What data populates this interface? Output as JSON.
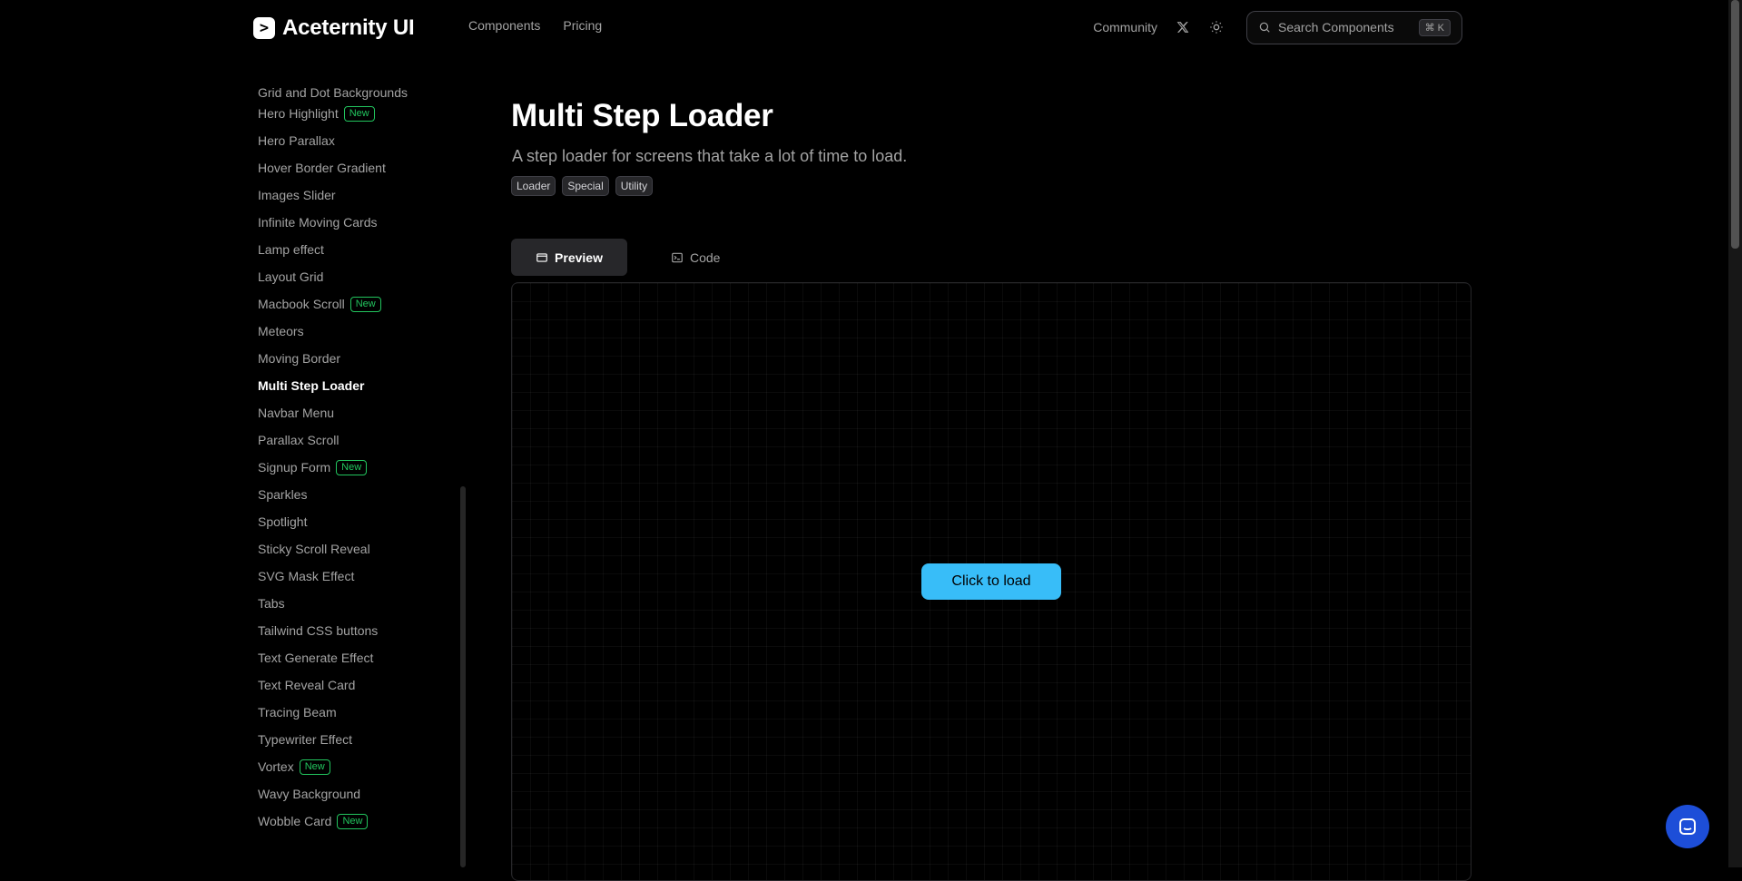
{
  "header": {
    "brand_logo_glyph": ">",
    "brand_name": "Aceternity UI",
    "nav": [
      "Components",
      "Pricing"
    ],
    "community": "Community",
    "search_label": "Search Components",
    "search_shortcut": "⌘ K"
  },
  "sidebar": {
    "items": [
      {
        "label": "Grid and Dot Backgrounds",
        "badge": ""
      },
      {
        "label": "Hero Highlight",
        "badge": "New"
      },
      {
        "label": "Hero Parallax",
        "badge": ""
      },
      {
        "label": "Hover Border Gradient",
        "badge": ""
      },
      {
        "label": "Images Slider",
        "badge": ""
      },
      {
        "label": "Infinite Moving Cards",
        "badge": ""
      },
      {
        "label": "Lamp effect",
        "badge": ""
      },
      {
        "label": "Layout Grid",
        "badge": ""
      },
      {
        "label": "Macbook Scroll",
        "badge": "New"
      },
      {
        "label": "Meteors",
        "badge": ""
      },
      {
        "label": "Moving Border",
        "badge": ""
      },
      {
        "label": "Multi Step Loader",
        "badge": "",
        "active": true
      },
      {
        "label": "Navbar Menu",
        "badge": ""
      },
      {
        "label": "Parallax Scroll",
        "badge": ""
      },
      {
        "label": "Signup Form",
        "badge": "New"
      },
      {
        "label": "Sparkles",
        "badge": ""
      },
      {
        "label": "Spotlight",
        "badge": ""
      },
      {
        "label": "Sticky Scroll Reveal",
        "badge": ""
      },
      {
        "label": "SVG Mask Effect",
        "badge": ""
      },
      {
        "label": "Tabs",
        "badge": ""
      },
      {
        "label": "Tailwind CSS buttons",
        "badge": ""
      },
      {
        "label": "Text Generate Effect",
        "badge": ""
      },
      {
        "label": "Text Reveal Card",
        "badge": ""
      },
      {
        "label": "Tracing Beam",
        "badge": ""
      },
      {
        "label": "Typewriter Effect",
        "badge": ""
      },
      {
        "label": "Vortex",
        "badge": "New"
      },
      {
        "label": "Wavy Background",
        "badge": ""
      },
      {
        "label": "Wobble Card",
        "badge": "New"
      }
    ]
  },
  "main": {
    "title": "Multi Step Loader",
    "subtitle": "A step loader for screens that take a lot of time to load.",
    "tags": [
      "Loader",
      "Special",
      "Utility"
    ],
    "tabs": [
      {
        "label": "Preview",
        "icon": "window-icon",
        "active": true
      },
      {
        "label": "Code",
        "icon": "terminal-icon",
        "active": false
      }
    ],
    "preview": {
      "button_label": "Click to load"
    }
  },
  "colors": {
    "background": "#000000",
    "accent_button": "#38bdf8",
    "badge_green": "#22c55e",
    "chat_button": "#1d4ed8"
  }
}
